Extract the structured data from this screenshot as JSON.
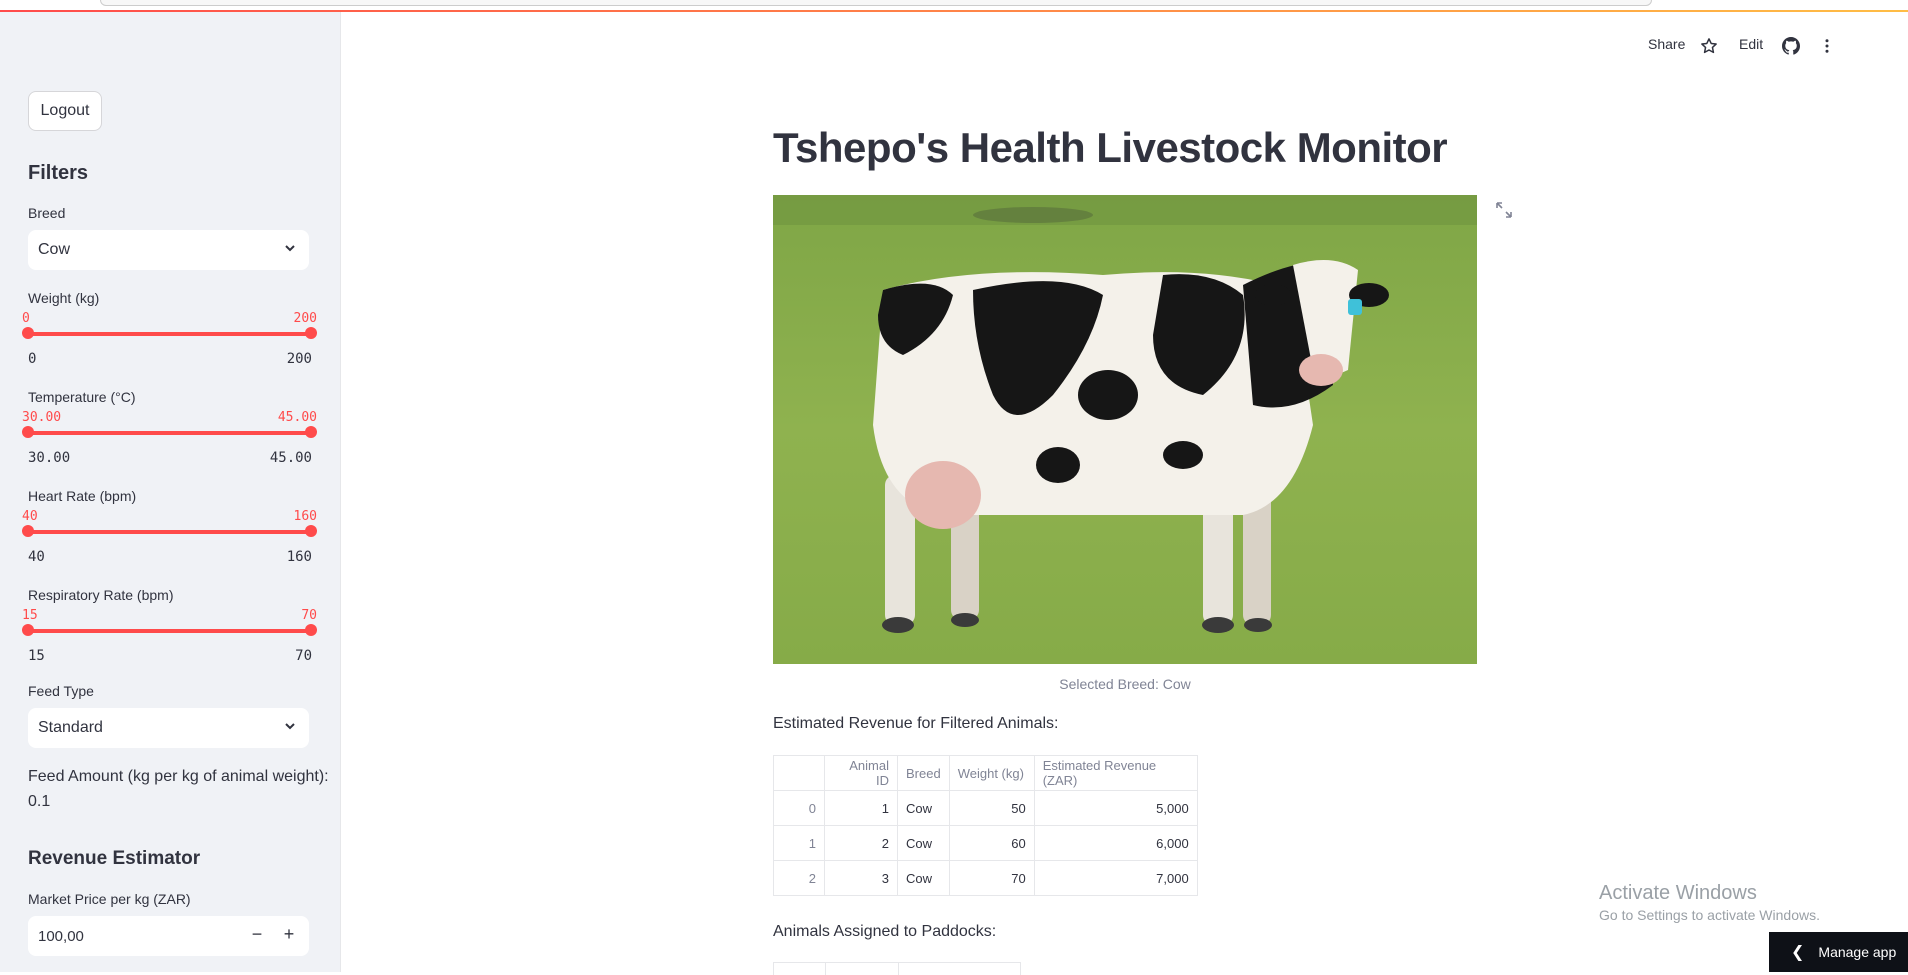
{
  "sidebar": {
    "logout_label": "Logout",
    "filters_heading": "Filters",
    "breed": {
      "label": "Breed",
      "value": "Cow"
    },
    "weight": {
      "label": "Weight (kg)",
      "min": "0",
      "max": "200",
      "range_min": "0",
      "range_max": "200",
      "fill_low": 0.0,
      "fill_high": 1.0
    },
    "temperature": {
      "label": "Temperature (°C)",
      "min": "30.00",
      "max": "45.00",
      "range_min": "30.00",
      "range_max": "45.00",
      "fill_low": 0.0,
      "fill_high": 1.0
    },
    "heart_rate": {
      "label": "Heart Rate (bpm)",
      "min": "40",
      "max": "160",
      "range_min": "40",
      "range_max": "160",
      "fill_low": 0.0,
      "fill_high": 1.0
    },
    "respiratory_rate": {
      "label": "Respiratory Rate (bpm)",
      "min": "15",
      "max": "70",
      "range_min": "15",
      "range_max": "70",
      "fill_low": 0.0,
      "fill_high": 1.0
    },
    "feed_type": {
      "label": "Feed Type",
      "value": "Standard"
    },
    "feed_amount": {
      "label": "Feed Amount (kg per kg of animal weight):",
      "value": "0.1"
    },
    "revenue_heading": "Revenue Estimator",
    "market_price": {
      "label": "Market Price per kg (ZAR)",
      "value": "100,00",
      "minus": "−",
      "plus": "+"
    }
  },
  "toolbar": {
    "share": "Share",
    "edit": "Edit"
  },
  "main": {
    "title": "Tshepo's Health Livestock Monitor",
    "image_caption": "Selected Breed: Cow",
    "revenue_heading": "Estimated Revenue for Filtered Animals:",
    "table": {
      "columns": [
        "",
        "Animal ID",
        "Breed",
        "Weight (kg)",
        "Estimated Revenue (ZAR)"
      ],
      "rows": [
        [
          "0",
          "1",
          "Cow",
          "50",
          "5,000"
        ],
        [
          "1",
          "2",
          "Cow",
          "60",
          "6,000"
        ],
        [
          "2",
          "3",
          "Cow",
          "70",
          "7,000"
        ]
      ]
    },
    "paddocks_heading": "Animals Assigned to Paddocks:"
  },
  "watermark": {
    "line1": "Activate Windows",
    "line2": "Go to Settings to activate Windows."
  },
  "manage_app": "Manage app",
  "colors": {
    "accent": "#ff4b4b",
    "sidebar_bg": "#f0f2f6",
    "text": "#31333f"
  }
}
